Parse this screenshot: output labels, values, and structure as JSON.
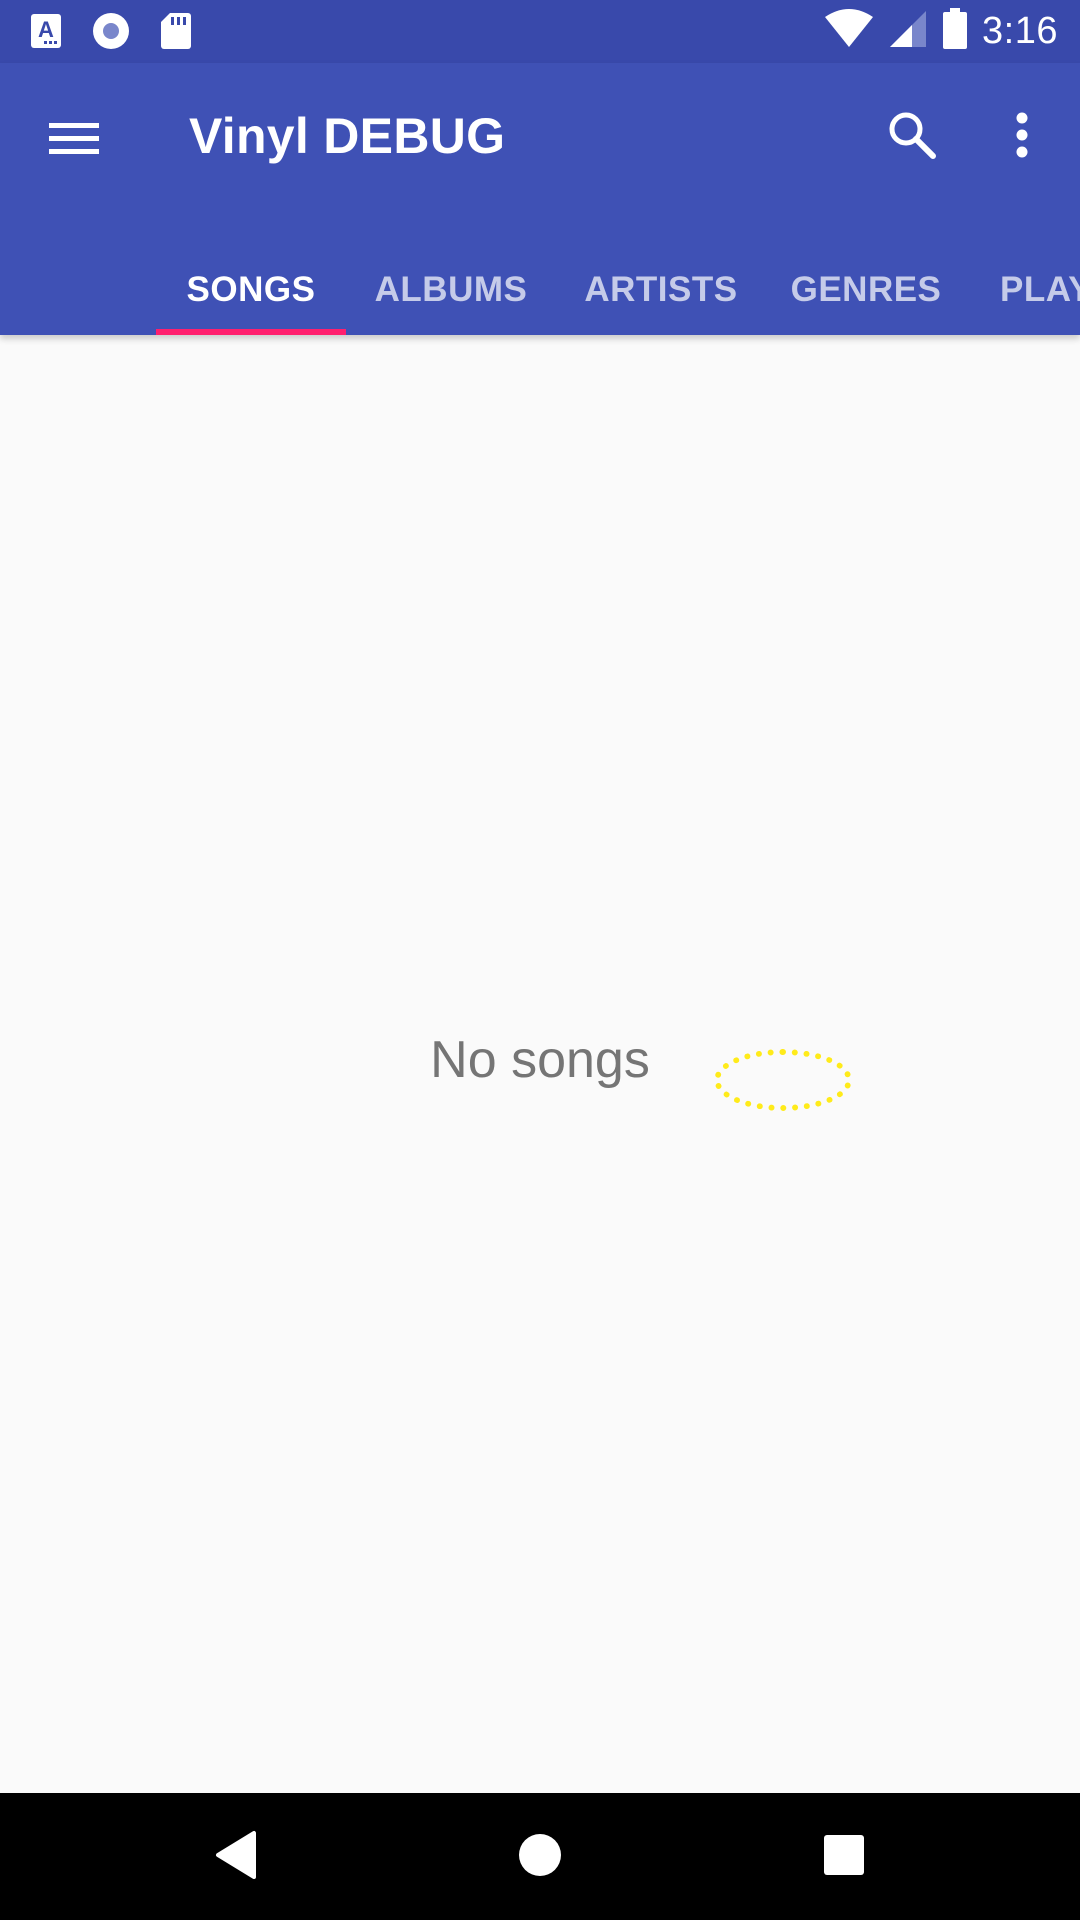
{
  "status_bar": {
    "time": "3:16",
    "left_icons": [
      "text-a-icon",
      "record-icon",
      "sd-card-icon"
    ],
    "right_icons": [
      "wifi-icon",
      "cell-signal-icon",
      "battery-icon"
    ]
  },
  "app_bar": {
    "title": "Vinyl DEBUG",
    "icons": {
      "menu": "menu-icon",
      "search": "search-icon",
      "overflow": "overflow-icon"
    }
  },
  "tabs": [
    {
      "label": "SONGS",
      "active": true
    },
    {
      "label": "ALBUMS",
      "active": false
    },
    {
      "label": "ARTISTS",
      "active": false
    },
    {
      "label": "GENRES",
      "active": false
    },
    {
      "label": "PLAYLISTS",
      "active": false
    }
  ],
  "main": {
    "empty_message": "No songs"
  },
  "nav_bar": {
    "icons": [
      "back-icon",
      "home-icon",
      "recents-icon"
    ]
  },
  "colors": {
    "status_bar": "#3949ab",
    "app_bar": "#3f51b5",
    "tab_indicator": "#ff1f6e",
    "background": "#fafafa",
    "highlight_ring": "#ffeb1a"
  }
}
